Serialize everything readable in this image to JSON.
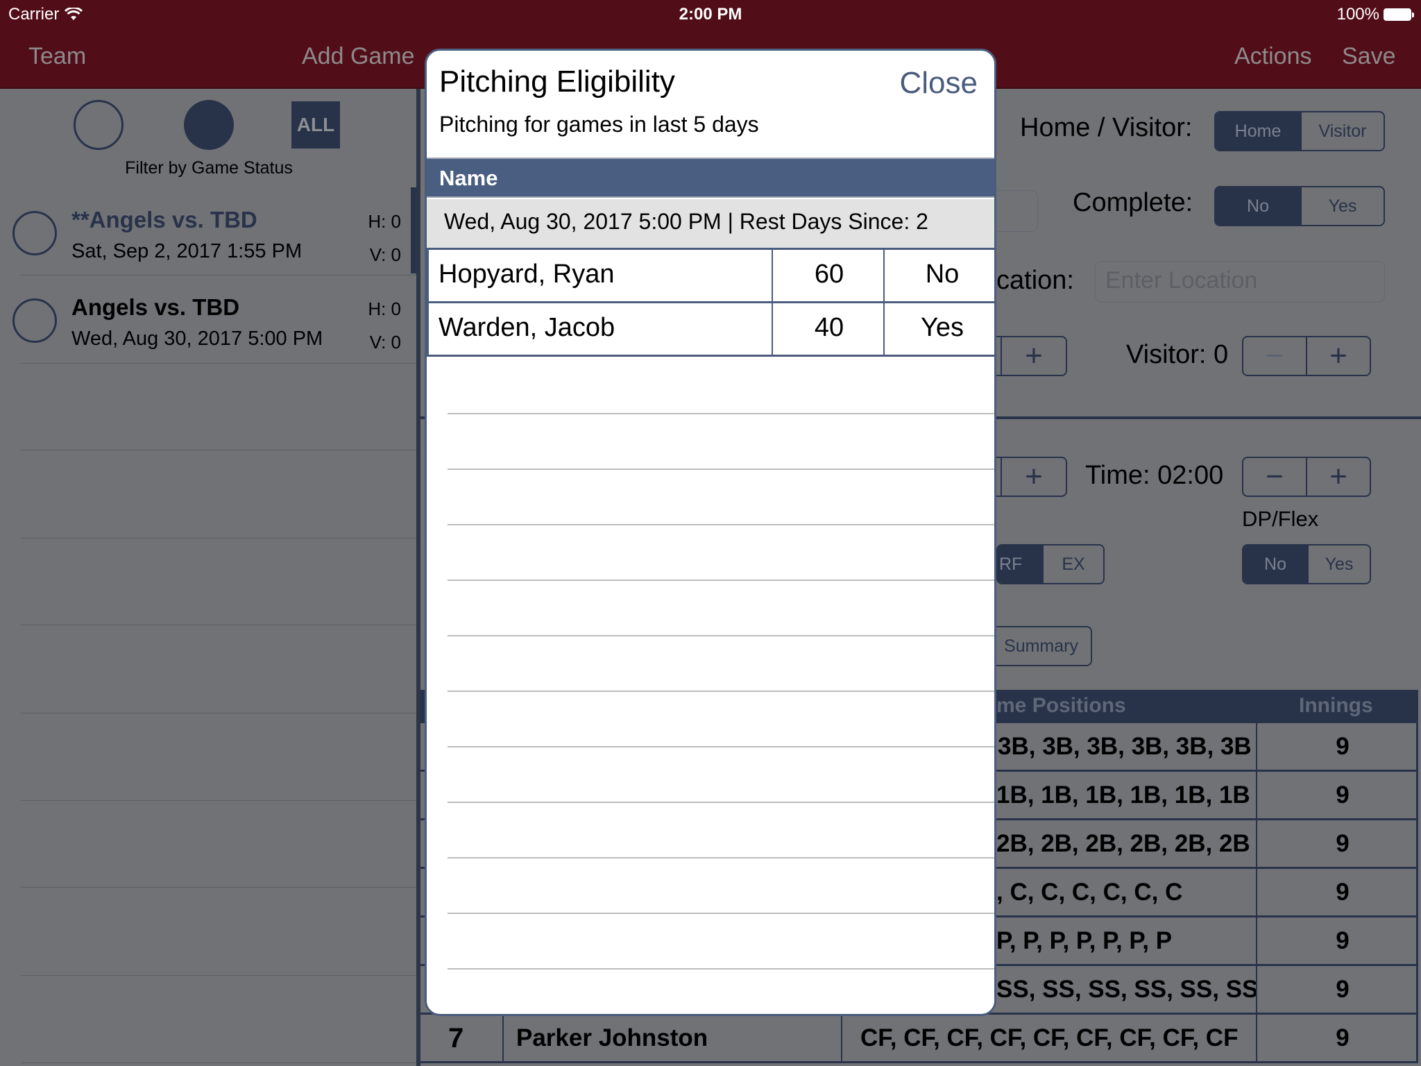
{
  "status_bar": {
    "carrier": "Carrier",
    "time": "2:00 PM",
    "battery": "100%"
  },
  "nav": {
    "team": "Team",
    "add_game": "Add Game",
    "actions": "Actions",
    "save": "Save"
  },
  "filter": {
    "all_label": "ALL",
    "label": "Filter by Game Status"
  },
  "games": [
    {
      "title": "**Angels vs. TBD",
      "date": "Sat, Sep 2, 2017 1:55 PM",
      "home": "H:  0",
      "visitor": "V:  0",
      "selected": true
    },
    {
      "title": "Angels vs. TBD",
      "date": "Wed, Aug 30, 2017 5:00 PM",
      "home": "H:  0",
      "visitor": "V:  0",
      "selected": false
    }
  ],
  "detail": {
    "home_visitor_label": "Home / Visitor:",
    "home_visitor_options": [
      "Home",
      "Visitor"
    ],
    "home_visitor_selected": "Home",
    "complete_label": "Complete:",
    "complete_options": [
      "No",
      "Yes"
    ],
    "complete_selected": "No",
    "location_label": "cation:",
    "location_placeholder": "Enter Location",
    "visitor_score_label": "Visitor: 0",
    "time_label": "Time: 02:00",
    "dpflex_label": "DP/Flex",
    "dpflex_options": [
      "No",
      "Yes"
    ],
    "dpflex_selected": "No",
    "partial_seg_options": [
      "RF",
      "EX"
    ],
    "partial_seg_selected": "RF",
    "summary_label": "Summary",
    "minus": "−",
    "plus": "+"
  },
  "lineup": {
    "headers": {
      "positions": "me Positions",
      "innings": "Innings"
    },
    "rows": [
      {
        "order": "",
        "name": "",
        "positions": "3B, 3B, 3B, 3B, 3B, 3B",
        "innings": "9"
      },
      {
        "order": "",
        "name": "",
        "positions": "1B, 1B, 1B, 1B, 1B, 1B",
        "innings": "9"
      },
      {
        "order": "",
        "name": "",
        "positions": "2B, 2B, 2B, 2B, 2B, 2B",
        "innings": "9"
      },
      {
        "order": "",
        "name": "",
        "positions": ", C, C, C, C, C, C",
        "innings": "9"
      },
      {
        "order": "",
        "name": "",
        "positions": "P, P, P, P, P, P, P",
        "innings": "9"
      },
      {
        "order": "",
        "name": "",
        "positions": "SS, SS, SS, SS, SS, SS",
        "innings": "9"
      },
      {
        "order": "7",
        "name": "Parker Johnston",
        "positions": "CF, CF, CF, CF, CF, CF, CF, CF, CF",
        "innings": "9"
      }
    ]
  },
  "modal": {
    "title": "Pitching Eligibility",
    "close": "Close",
    "subtitle": "Pitching for games in last 5 days",
    "column_header": "Name",
    "section": "Wed, Aug 30, 2017 5:00 PM | Rest Days Since: 2",
    "rows": [
      {
        "name": "Hopyard, Ryan",
        "pitches": "60",
        "eligible": "No"
      },
      {
        "name": "Warden, Jacob",
        "pitches": "40",
        "eligible": "Yes"
      }
    ]
  },
  "colors": {
    "nav_bg": "#520e18",
    "accent": "#4a5c7e",
    "header_blue": "#4a5e82",
    "dark_navy": "#28334a"
  }
}
